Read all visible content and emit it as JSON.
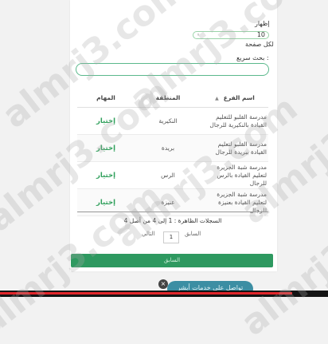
{
  "form": {
    "show_label": "إظهار",
    "entries_value": "10",
    "per_page_label": "لكل صفحة",
    "search_label": "بحث سريع :",
    "search_value": ""
  },
  "table": {
    "headers": {
      "branch": "اسم الفرع",
      "region": "المنطقة",
      "tasks": "المهام"
    },
    "rows": [
      {
        "name": "مدرسة القلبو للتعليم القيادة بالنكيرية للرجال",
        "region": "النكيرية",
        "action": "إختيار"
      },
      {
        "name": "مدرسة القلبو لتعليم القيادة ببريدة للرجال",
        "region": "بريدة",
        "action": "إختيار"
      },
      {
        "name": "مدرسة شبة الجزيرة لتعليم القيادة بالرس للرجال",
        "region": "الرس",
        "action": "إختيار"
      },
      {
        "name": "مدرسة شبة الجزيرة لتعليم القيادة بعنيزة للرجال",
        "region": "عنيزة",
        "action": "إختيار"
      }
    ]
  },
  "pagination": {
    "info": "السجلات الظاهرة : 1 إلى 4 من أصل 4",
    "prev": "السابق",
    "page": "1",
    "next": "التالي"
  },
  "footer": {
    "back_button": "السابق"
  },
  "chat": {
    "label": "تواصل على خدمات أبشر",
    "close": "×"
  },
  "watermark": "almrj3.com",
  "video_progress": 0.89,
  "colors": {
    "accent": "#2e9960",
    "input_border": "#5bb98c",
    "choose": "#2e9f5a",
    "chat": "#3c8ea3"
  }
}
